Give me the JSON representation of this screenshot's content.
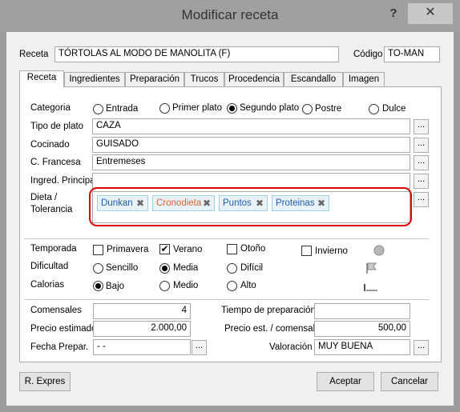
{
  "window": {
    "title": "Modificar receta",
    "help_label": "?",
    "close_label": "✕"
  },
  "header": {
    "receta_label": "Receta",
    "receta_value": "TÓRTOLAS AL MODO DE MANOLITA   (F)",
    "codigo_label": "Código",
    "codigo_value": "TO-MAN"
  },
  "tabs": [
    "Receta",
    "Ingredientes",
    "Preparación",
    "Trucos",
    "Procedencia",
    "Escandallo",
    "Imagen"
  ],
  "categoria": {
    "label": "Categoria",
    "options": [
      "Entrada",
      "Primer plato",
      "Segundo plato",
      "Postre",
      "Dulce"
    ],
    "selected": "Segundo plato"
  },
  "fields": {
    "tipo_plato": {
      "label": "Tipo de plato",
      "value": "CAZA"
    },
    "cocinado": {
      "label": "Cocinado",
      "value": "GUISADO"
    },
    "c_francesa": {
      "label": "C. Francesa",
      "value": "Entremeses"
    },
    "ingred_principal": {
      "label": "Ingred. Principal",
      "value": ""
    },
    "dieta": {
      "label_line1": "Dieta /",
      "label_line2": "Tolerancia"
    }
  },
  "dieta_tags": [
    {
      "label": "Dunkan",
      "color": "#1f5fa8"
    },
    {
      "label": "Cronodieta",
      "color": "#e0632a"
    },
    {
      "label": "Puntos",
      "color": "#1f5fa8"
    },
    {
      "label": "Proteinas",
      "color": "#1f5fa8"
    }
  ],
  "temporada": {
    "label": "Temporada",
    "options": [
      {
        "label": "Primavera",
        "checked": false
      },
      {
        "label": "Verano",
        "checked": true
      },
      {
        "label": "Otoño",
        "checked": false
      },
      {
        "label": "Invierno",
        "checked": false
      }
    ]
  },
  "dificultad": {
    "label": "Dificultad",
    "options": [
      "Sencillo",
      "Media",
      "Difícil"
    ],
    "selected": "Media"
  },
  "calorias": {
    "label": "Calorias",
    "options": [
      "Bajo",
      "Medio",
      "Alto"
    ],
    "selected": "Bajo"
  },
  "numbers": {
    "comensales_label": "Comensales",
    "comensales_value": "4",
    "tiempo_label": "Tiempo de preparación",
    "tiempo_value": "",
    "precio_label": "Precio estimado",
    "precio_value": "2.000,00",
    "precio_comensal_label": "Precio est. / comensal",
    "precio_comensal_value": "500,00",
    "fecha_label": "Fecha Prepar.",
    "fecha_value": "  -  -",
    "valoracion_label": "Valoración",
    "valoracion_value": "MUY BUENA"
  },
  "buttons": {
    "express": "R. Expres",
    "accept": "Aceptar",
    "cancel": "Cancelar",
    "dots": "..."
  },
  "icons": {
    "invierno": "snowflake-icon",
    "dificultad": "flag-icon",
    "calorias": "bar-level-icon"
  },
  "colors": {
    "highlight": "#e00000"
  }
}
